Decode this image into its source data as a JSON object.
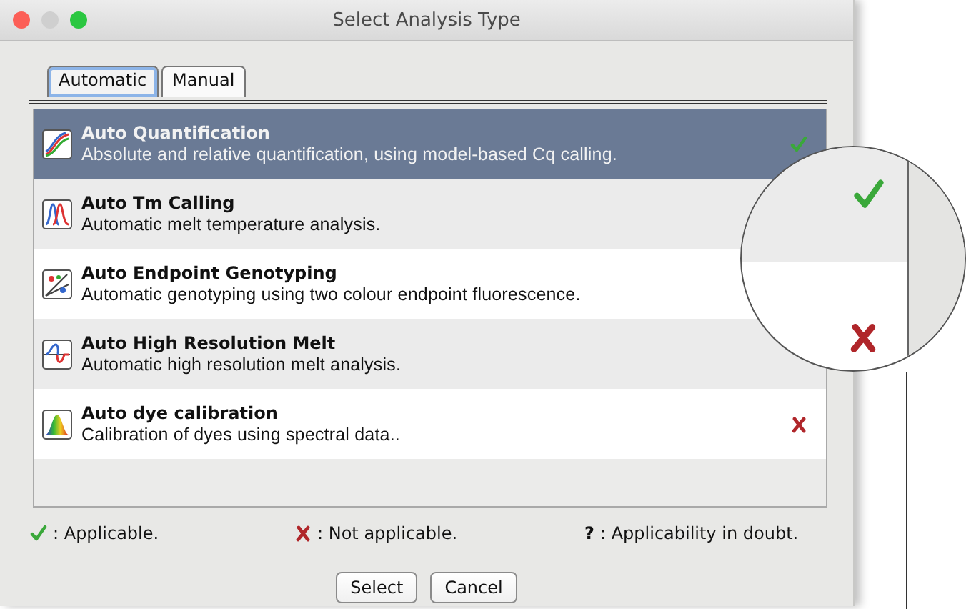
{
  "window": {
    "title": "Select Analysis Type"
  },
  "tabs": [
    {
      "label": "Automatic",
      "selected": true
    },
    {
      "label": "Manual",
      "selected": false
    }
  ],
  "rows": [
    {
      "title": "Auto Quantification",
      "description": "Absolute and relative quantification, using model-based Cq calling.",
      "selected": true,
      "applicable": true,
      "not_applicable": false
    },
    {
      "title": "Auto Tm Calling",
      "description": "Automatic melt temperature analysis.",
      "selected": false,
      "applicable": false,
      "not_applicable": false
    },
    {
      "title": "Auto Endpoint Genotyping",
      "description": "Automatic genotyping using two colour endpoint fluorescence.",
      "selected": false,
      "applicable": false,
      "not_applicable": false
    },
    {
      "title": "Auto High Resolution Melt",
      "description": "Automatic high resolution melt analysis.",
      "selected": false,
      "applicable": false,
      "not_applicable": false
    },
    {
      "title": "Auto dye calibration",
      "description": "Calibration of dyes using spectral data..",
      "selected": false,
      "applicable": false,
      "not_applicable": true
    }
  ],
  "legend": [
    {
      "kind": "applicable",
      "label": ": Applicable."
    },
    {
      "kind": "not_applicable",
      "label": ": Not applicable."
    },
    {
      "kind": "doubt",
      "symbol": "?",
      "label": ": Applicability in doubt."
    }
  ],
  "buttons": [
    "Select",
    "Cancel"
  ]
}
